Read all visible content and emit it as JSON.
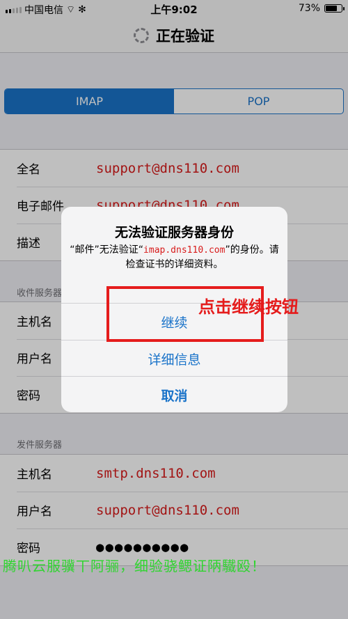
{
  "status_bar": {
    "carrier": "中国电信",
    "time": "上午9:02",
    "battery": "73%",
    "battery_level": 0.73
  },
  "nav": {
    "title": "正在验证"
  },
  "segment": {
    "options": [
      "IMAP",
      "POP"
    ],
    "selected": "IMAP"
  },
  "account": {
    "rows": [
      {
        "label": "全名",
        "value": "support@dns110.com"
      },
      {
        "label": "电子邮件",
        "value": "support@dns110.com"
      },
      {
        "label": "描述",
        "value": ""
      }
    ]
  },
  "incoming": {
    "header": "收件服务器",
    "rows": [
      {
        "label": "主机名",
        "value": ""
      },
      {
        "label": "用户名",
        "value": ""
      },
      {
        "label": "密码",
        "value": ""
      }
    ]
  },
  "outgoing": {
    "header": "发件服务器",
    "rows": [
      {
        "label": "主机名",
        "value": "smtp.dns110.com"
      },
      {
        "label": "用户名",
        "value": "support@dns110.com"
      },
      {
        "label": "密码",
        "value": "●●●●●●●●●●"
      }
    ]
  },
  "alert": {
    "title": "无法验证服务器身份",
    "message_prefix": "“邮件”无法验证“",
    "host": "imap.dns110.com",
    "message_suffix": "”的身份。请检查证书的详细资料。",
    "buttons": {
      "continue": "继续",
      "details": "详细信息",
      "cancel": "取消"
    }
  },
  "annotation": {
    "text": "点击继续按钮"
  },
  "watermark": {
    "text": "腾叭云服骥丅阿骊，细验骁鳃证陃驖殴！"
  },
  "colors": {
    "accent": "#1a73c9",
    "annotation": "#e51c1c"
  }
}
